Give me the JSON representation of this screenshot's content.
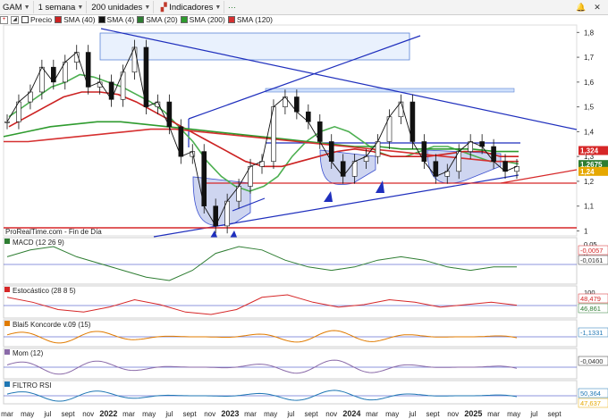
{
  "toolbar": {
    "symbol": "GAM",
    "period": "1 semana",
    "units": "200 unidades",
    "indicators": "Indicadores"
  },
  "legend": {
    "price": "Precio",
    "sma40": "SMA (40)",
    "sma4": "SMA (4)",
    "sma20": "SMA (20)",
    "sma200": "SMA (200)",
    "sma120": "SMA (120)",
    "colors": {
      "sma40": "#cc2222",
      "sma4": "#111111",
      "sma20": "#2e7d32",
      "sma200": "#2e9b2e",
      "sma120": "#d63030"
    }
  },
  "source_note": "ProRealTime.com - Fin de Día",
  "chart_data": [
    {
      "type": "line",
      "title": "GAM",
      "y_ticks": [
        "1,8",
        "1,7",
        "1,6",
        "1,5",
        "1,4",
        "1,3",
        "1,2",
        "1,1",
        "1"
      ],
      "ylim": [
        0.98,
        1.83
      ],
      "price_labels": [
        {
          "text": "1,324",
          "color": "#d62728"
        },
        {
          "text": "1,2675",
          "color": "#2e7d32"
        },
        {
          "text": "1,24",
          "color": "#e6a800"
        }
      ],
      "x_labels": [
        "mar",
        "may",
        "jul",
        "sept",
        "nov",
        "2022",
        "mar",
        "may",
        "jul",
        "sept",
        "nov",
        "2023",
        "mar",
        "may",
        "jul",
        "sept",
        "nov",
        "2024",
        "mar",
        "may",
        "jul",
        "sept",
        "nov",
        "2025",
        "mar",
        "may",
        "jul",
        "sept"
      ],
      "series": [
        {
          "name": "Precio",
          "values": [
            1.44,
            1.52,
            1.56,
            1.66,
            1.6,
            1.68,
            1.72,
            1.58,
            1.6,
            1.53,
            1.64,
            1.74,
            1.5,
            1.52,
            1.42,
            1.3,
            1.32,
            1.1,
            1.02,
            1.12,
            1.18,
            1.26,
            1.28,
            1.5,
            1.54,
            1.48,
            1.44,
            1.36,
            1.28,
            1.22,
            1.28,
            1.3,
            1.36,
            1.46,
            1.52,
            1.36,
            1.28,
            1.22,
            1.24,
            1.32,
            1.36,
            1.34,
            1.28,
            1.24,
            1.26
          ]
        },
        {
          "name": "SMA (20)",
          "values": [
            1.46,
            1.5,
            1.54,
            1.58,
            1.6,
            1.63,
            1.62,
            1.6,
            1.58,
            1.55,
            1.52,
            1.48,
            1.42,
            1.36,
            1.28,
            1.22,
            1.18,
            1.16,
            1.18,
            1.22,
            1.3,
            1.36,
            1.4,
            1.42,
            1.4,
            1.36,
            1.32,
            1.3,
            1.3,
            1.32,
            1.34,
            1.34,
            1.32,
            1.3,
            1.28,
            1.28,
            1.27
          ]
        },
        {
          "name": "SMA (40)",
          "values": [
            1.42,
            1.46,
            1.5,
            1.54,
            1.56,
            1.56,
            1.55,
            1.52,
            1.48,
            1.44,
            1.4,
            1.36,
            1.32,
            1.28,
            1.26,
            1.26,
            1.28,
            1.3,
            1.32,
            1.33,
            1.32,
            1.3,
            1.3,
            1.3,
            1.31,
            1.32,
            1.32,
            1.3,
            1.3
          ]
        },
        {
          "name": "SMA (200)",
          "values": [
            1.38,
            1.4,
            1.42,
            1.43,
            1.44,
            1.44,
            1.43,
            1.42,
            1.41,
            1.4,
            1.39,
            1.38,
            1.37,
            1.36,
            1.35,
            1.34,
            1.34,
            1.33,
            1.33,
            1.33,
            1.33,
            1.32,
            1.32
          ]
        },
        {
          "name": "SMA (120)",
          "values": [
            1.36,
            1.36,
            1.37,
            1.38,
            1.39,
            1.4,
            1.41,
            1.41,
            1.4,
            1.39,
            1.38,
            1.37,
            1.36,
            1.35,
            1.34,
            1.33,
            1.32,
            1.31,
            1.3,
            1.29,
            1.28,
            1.28
          ]
        }
      ]
    },
    {
      "type": "line",
      "title": "MACD (12 26 9)",
      "y_ticks": [
        "0,05",
        "0"
      ],
      "price_labels": [
        {
          "text": "-0,0057",
          "color": "#d62728"
        },
        {
          "text": "-0,0161",
          "color": "#333333"
        }
      ],
      "series": [
        {
          "name": "MACD (12 26 9)",
          "values": [
            0.02,
            0.04,
            0.05,
            0.02,
            0.0,
            -0.02,
            -0.04,
            -0.05,
            -0.02,
            0.03,
            0.05,
            0.04,
            0.01,
            -0.01,
            -0.02,
            -0.01,
            0.01,
            0.02,
            0.01,
            -0.01,
            -0.02,
            -0.01,
            -0.01
          ]
        }
      ]
    },
    {
      "type": "line",
      "title": "Estocástico (28 8 5)",
      "y_ticks": [
        "100"
      ],
      "price_labels": [
        {
          "text": "48,479",
          "color": "#d62728"
        },
        {
          "text": "46,861",
          "color": "#2e7d32"
        }
      ],
      "series": [
        {
          "name": "Estocástico (28 8 5)",
          "values": [
            80,
            60,
            30,
            20,
            40,
            70,
            50,
            20,
            10,
            30,
            80,
            90,
            60,
            40,
            50,
            70,
            60,
            40,
            50,
            60,
            48
          ]
        }
      ]
    },
    {
      "type": "area",
      "title": "Blai5 Koncorde v.09 (15)",
      "price_labels": [
        {
          "text": "-1,1331",
          "color": "#1f77b4"
        }
      ]
    },
    {
      "type": "bar",
      "title": "Mom (12)",
      "price_labels": [
        {
          "text": "-0,0400",
          "color": "#333333"
        }
      ]
    },
    {
      "type": "line",
      "title": "FILTRO RSI",
      "price_labels": [
        {
          "text": "50,364",
          "color": "#1f77b4"
        },
        {
          "text": "47,637",
          "color": "#e6a800"
        }
      ]
    }
  ]
}
